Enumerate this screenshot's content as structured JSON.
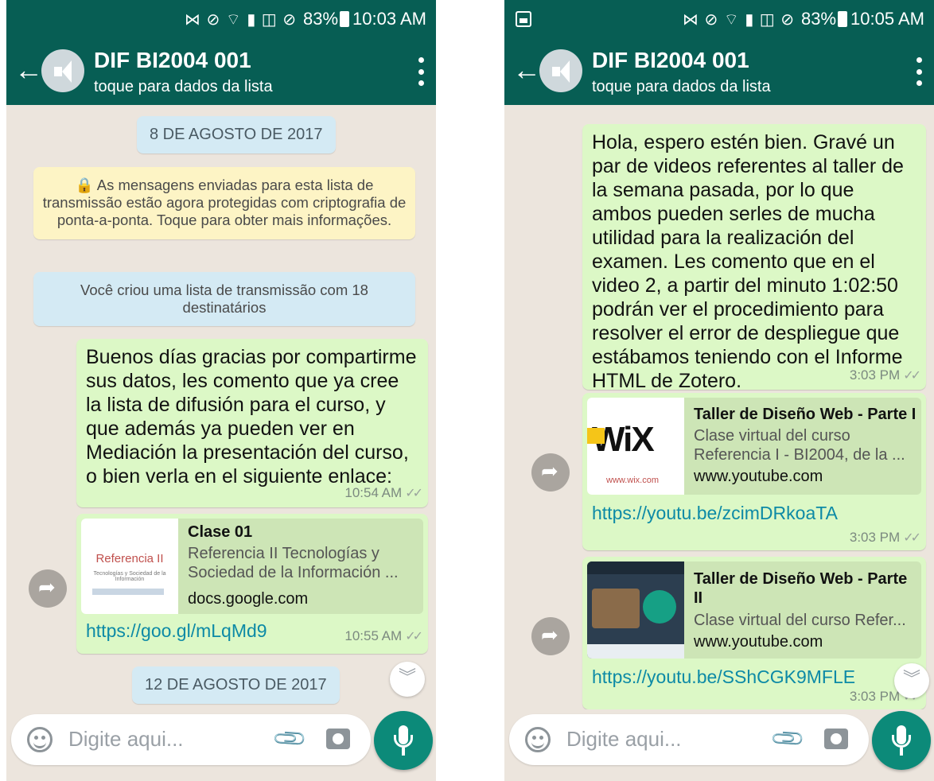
{
  "left": {
    "statusbar": {
      "icons": "⋈ ⊘ ⌔ ▮ ◫ ⊘",
      "battery": "83%",
      "time": "10:03 AM"
    },
    "header": {
      "title": "DIF BI2004 001",
      "subtitle": "toque para dados da lista"
    },
    "date1": "8 DE AGOSTO DE 2017",
    "encryption_notice": "🔒 As mensagens enviadas para esta lista de transmissão estão agora protegidas com criptografia de ponta-a-ponta. Toque para obter mais informações.",
    "created_notice": "Você criou uma lista de transmissão com 18 destinatários",
    "message1": {
      "text": "Buenos días gracias por compartirme sus datos, les comento que ya cree la lista de difusión para el curso, y que además ya pueden ver en Mediación la presentación del curso, o bien verla en el siguiente enlace:",
      "time": "10:54 AM"
    },
    "message2": {
      "preview_title": "Clase 01",
      "preview_desc": "Referencia II Tecnologías y Sociedad de la Información ...",
      "preview_host": "docs.google.com",
      "thumb_title": "Referencia II",
      "thumb_sub": "Tecnologías y Sociedad de la Información",
      "link": "https://goo.gl/mLqMd9",
      "time": "10:55 AM"
    },
    "date2": "12 DE AGOSTO DE 2017",
    "composer_placeholder": "Digite aqui..."
  },
  "right": {
    "statusbar": {
      "icons": "⋈ ⊘ ⌔ ▮ ◫ ⊘",
      "battery": "83%",
      "time": "10:05 AM"
    },
    "header": {
      "title": "DIF BI2004 001",
      "subtitle": "toque para dados da lista"
    },
    "message1": {
      "text": "Hola, espero estén bien. Gravé un par de videos referentes al taller de la semana pasada, por lo que ambos pueden serles de mucha utilidad para la realización del examen. Les comento que en el video 2, a partir del minuto 1:02:50 podrán ver el procedimiento para resolver el error de despliegue que estábamos teniendo con el Informe HTML de Zotero.",
      "time": "3:03 PM"
    },
    "message2": {
      "preview_title": "Taller de Diseño Web - Parte I",
      "preview_desc": "Clase virtual del curso Referencia I - BI2004, de la ...",
      "preview_host": "www.youtube.com",
      "thumb_logo": "WiX",
      "thumb_url": "www.wix.com",
      "link": "https://youtu.be/zcimDRkoaTA",
      "time": "3:03 PM"
    },
    "message3": {
      "preview_title": "Taller de Diseño Web - Parte II",
      "preview_desc": "Clase virtual del curso Refer...",
      "preview_host": "www.youtube.com",
      "link": "https://youtu.be/SShCGK9MFLE",
      "time": "3:03 PM"
    },
    "composer_placeholder": "Digite aqui..."
  },
  "colors": {
    "header": "#075e54",
    "bubble": "#dcf8c6",
    "chat_bg": "#ece5dd",
    "accent": "#0c8a79",
    "link": "#0d8aa6"
  }
}
